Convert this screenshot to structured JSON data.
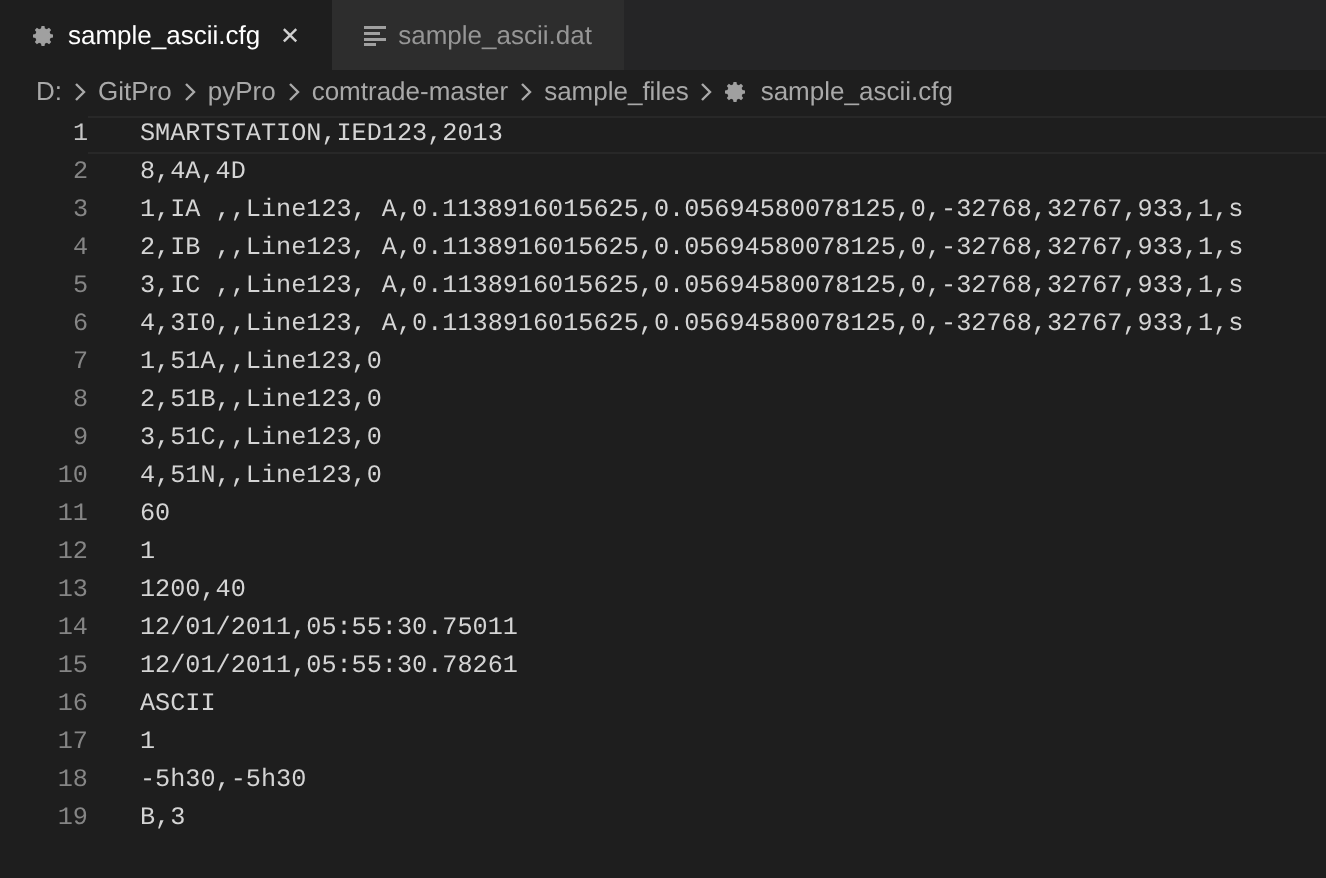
{
  "tabs": [
    {
      "label": "sample_ascii.cfg",
      "kind": "config",
      "selected": true,
      "closable": true,
      "close": "✕"
    },
    {
      "label": "sample_ascii.dat",
      "kind": "data",
      "selected": false,
      "closable": false
    }
  ],
  "breadcrumb": [
    {
      "label": "D:",
      "kind": "folder"
    },
    {
      "label": "GitPro",
      "kind": "folder"
    },
    {
      "label": "pyPro",
      "kind": "folder"
    },
    {
      "label": "comtrade-master",
      "kind": "folder"
    },
    {
      "label": "sample_files",
      "kind": "folder"
    },
    {
      "label": "sample_ascii.cfg",
      "kind": "config"
    }
  ],
  "editor": {
    "lines": [
      {
        "number": "1",
        "text": "SMARTSTATION,IED123,2013",
        "current": true
      },
      {
        "number": "2",
        "text": "8,4A,4D",
        "current": false
      },
      {
        "number": "3",
        "text": "1,IA ,,Line123, A,0.1138916015625,0.05694580078125,0,-32768,32767,933,1,s",
        "current": false
      },
      {
        "number": "4",
        "text": "2,IB ,,Line123, A,0.1138916015625,0.05694580078125,0,-32768,32767,933,1,s",
        "current": false
      },
      {
        "number": "5",
        "text": "3,IC ,,Line123, A,0.1138916015625,0.05694580078125,0,-32768,32767,933,1,s",
        "current": false
      },
      {
        "number": "6",
        "text": "4,3I0,,Line123, A,0.1138916015625,0.05694580078125,0,-32768,32767,933,1,s",
        "current": false
      },
      {
        "number": "7",
        "text": "1,51A,,Line123,0",
        "current": false
      },
      {
        "number": "8",
        "text": "2,51B,,Line123,0",
        "current": false
      },
      {
        "number": "9",
        "text": "3,51C,,Line123,0",
        "current": false
      },
      {
        "number": "10",
        "text": "4,51N,,Line123,0",
        "current": false
      },
      {
        "number": "11",
        "text": "60",
        "current": false
      },
      {
        "number": "12",
        "text": "1",
        "current": false
      },
      {
        "number": "13",
        "text": "1200,40",
        "current": false
      },
      {
        "number": "14",
        "text": "12/01/2011,05:55:30.75011",
        "current": false
      },
      {
        "number": "15",
        "text": "12/01/2011,05:55:30.78261",
        "current": false
      },
      {
        "number": "16",
        "text": "ASCII",
        "current": false
      },
      {
        "number": "17",
        "text": "1",
        "current": false
      },
      {
        "number": "18",
        "text": "-5h30,-5h30",
        "current": false
      },
      {
        "number": "19",
        "text": "B,3",
        "current": false
      }
    ]
  }
}
